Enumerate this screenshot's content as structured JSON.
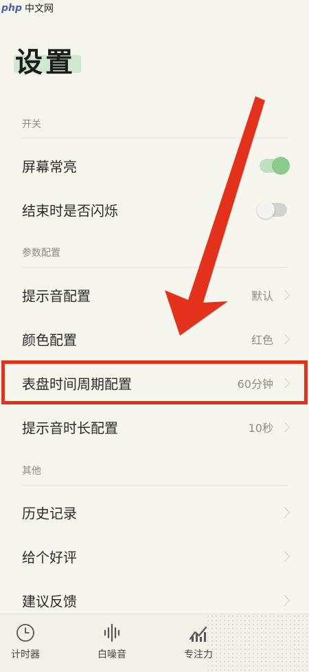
{
  "watermark": {
    "logo": "php",
    "text": "中文网"
  },
  "page": {
    "title": "设置"
  },
  "sections": {
    "switches": "开关",
    "params": "参数配置",
    "others": "其他"
  },
  "switch_items": [
    {
      "label": "屏幕常亮",
      "state": "on"
    },
    {
      "label": "结束时是否闪烁",
      "state": "off"
    }
  ],
  "param_items": [
    {
      "label": "提示音配置",
      "value": "默认"
    },
    {
      "label": "颜色配置",
      "value": "红色"
    },
    {
      "label": "表盘时间周期配置",
      "value": "60分钟"
    },
    {
      "label": "提示音时长配置",
      "value": "10秒"
    }
  ],
  "other_items": [
    {
      "label": "历史记录"
    },
    {
      "label": "给个好评"
    },
    {
      "label": "建议反馈"
    }
  ],
  "tabs": [
    {
      "label": "计时器",
      "icon": "clock-icon"
    },
    {
      "label": "白噪音",
      "icon": "sound-wave-icon"
    },
    {
      "label": "专注力",
      "icon": "chart-icon"
    }
  ],
  "colors": {
    "background": "#f7f6ee",
    "accent_green": "#8cc98c",
    "annotation_red": "#e3311b"
  }
}
